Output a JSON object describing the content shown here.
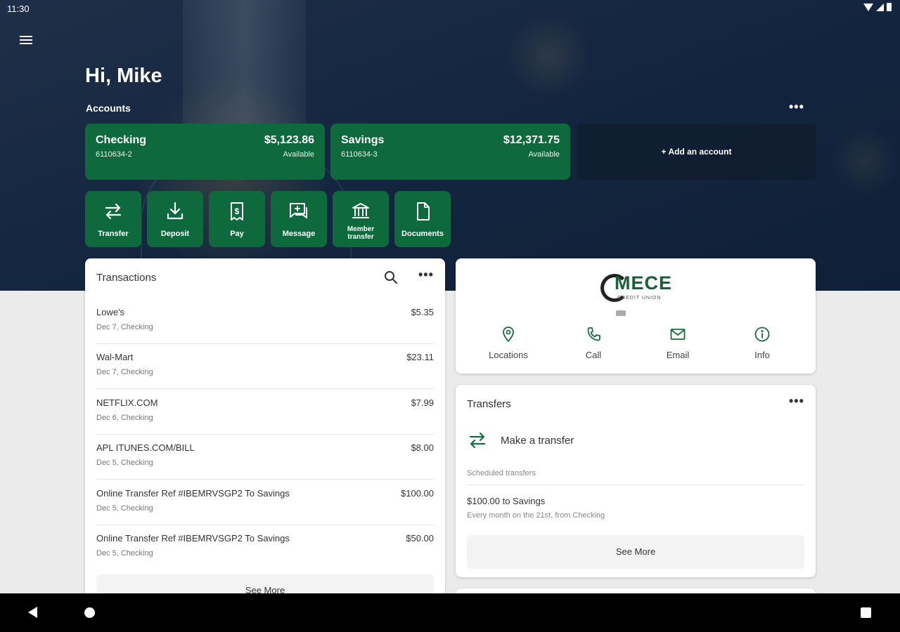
{
  "status_bar": {
    "time": "11:30"
  },
  "header": {
    "greeting": "Hi, Mike",
    "accounts_label": "Accounts",
    "more_label": "•••"
  },
  "accounts": [
    {
      "name": "Checking",
      "number": "6110634-2",
      "balance": "$5,123.86",
      "balance_label": "Available"
    },
    {
      "name": "Savings",
      "number": "6110634-3",
      "balance": "$12,371.75",
      "balance_label": "Available"
    }
  ],
  "add_account_label": "+ Add an account",
  "actions": [
    {
      "label": "Transfer",
      "icon": "transfer-icon"
    },
    {
      "label": "Deposit",
      "icon": "deposit-icon"
    },
    {
      "label": "Pay",
      "icon": "pay-icon"
    },
    {
      "label": "Message",
      "icon": "message-icon"
    },
    {
      "label": "Member transfer",
      "icon": "bank-icon"
    },
    {
      "label": "Documents",
      "icon": "document-icon"
    }
  ],
  "transactions": {
    "title": "Transactions",
    "more_label": "•••",
    "items": [
      {
        "description": "Lowe's",
        "meta": "Dec 7, Checking",
        "amount": "$5.35"
      },
      {
        "description": "Wal-Mart",
        "meta": "Dec 7, Checking",
        "amount": "$23.11"
      },
      {
        "description": "NETFLIX.COM",
        "meta": "Dec 6, Checking",
        "amount": "$7.99"
      },
      {
        "description": "APL ITUNES.COM/BILL",
        "meta": "Dec 5, Checking",
        "amount": "$8.00"
      },
      {
        "description": "Online Transfer Ref #IBEMRVSGP2 To Savings",
        "meta": "Dec 5, Checking",
        "amount": "$100.00"
      },
      {
        "description": "Online Transfer Ref #IBEMRVSGP2 To Savings",
        "meta": "Dec 5, Checking",
        "amount": "$50.00"
      }
    ],
    "see_more": "See More"
  },
  "brand": {
    "logo_text": "MECE",
    "logo_subtext": "CREDIT UNION",
    "contacts": [
      {
        "label": "Locations",
        "icon": "location-pin-icon"
      },
      {
        "label": "Call",
        "icon": "phone-icon"
      },
      {
        "label": "Email",
        "icon": "email-icon"
      },
      {
        "label": "Info",
        "icon": "info-icon"
      }
    ]
  },
  "transfers": {
    "title": "Transfers",
    "more_label": "•••",
    "make_transfer_label": "Make a transfer",
    "scheduled_label": "Scheduled transfers",
    "scheduled_title": "$100.00 to Savings",
    "scheduled_subtitle": "Every month on the 21st, from Checking",
    "see_more": "See More"
  },
  "colors": {
    "accent": "#0e6a3c",
    "hero_background": "#142640",
    "page_background": "#ebebeb"
  }
}
